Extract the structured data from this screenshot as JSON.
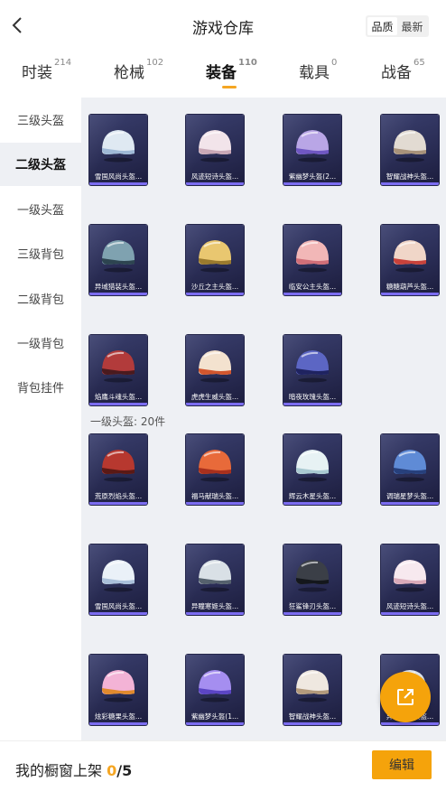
{
  "header": {
    "title": "游戏仓库",
    "sort_options": [
      "品质",
      "最新"
    ],
    "active_sort": 0
  },
  "tabs": [
    {
      "label": "时装",
      "count": "214"
    },
    {
      "label": "枪械",
      "count": "102"
    },
    {
      "label": "装备",
      "count": "110"
    },
    {
      "label": "载具",
      "count": "0"
    },
    {
      "label": "战备",
      "count": "65"
    }
  ],
  "active_tab": 2,
  "sidebar": {
    "items": [
      "三级头盔",
      "二级头盔",
      "一级头盔",
      "三级背包",
      "二级背包",
      "一级背包",
      "背包挂件"
    ],
    "active": 1
  },
  "sections": {
    "level1_label": "一级头盔: 20件"
  },
  "items": [
    {
      "name": "雪国风尚头盔...",
      "colors": [
        "#dfe9f2",
        "#9fb9d6"
      ]
    },
    {
      "name": "风迹短诗头盔...",
      "colors": [
        "#f2e4ea",
        "#c9a8b6"
      ]
    },
    {
      "name": "紫幽梦头盔(2...",
      "colors": [
        "#b9a6e6",
        "#6f57c2"
      ]
    },
    {
      "name": "智耀战神头盔...",
      "colors": [
        "#e2dbd2",
        "#a8927a"
      ]
    },
    {
      "name": "异域猎装头盔...",
      "colors": [
        "#7fa2b0",
        "#2d4450"
      ]
    },
    {
      "name": "沙丘之主头盔...",
      "colors": [
        "#e9c770",
        "#9a7a2e"
      ]
    },
    {
      "name": "临安公主头盔...",
      "colors": [
        "#f2b7b7",
        "#d06e78"
      ]
    },
    {
      "name": "糖糖葫芦头盔...",
      "colors": [
        "#f0d6c8",
        "#c8423b"
      ]
    },
    {
      "name": "焰鹰斗魂头盔...",
      "colors": [
        "#b23b3b",
        "#4a1a1e"
      ]
    },
    {
      "name": "虎虎生威头盔...",
      "colors": [
        "#f3e2cf",
        "#d2562e"
      ]
    },
    {
      "name": "暗夜玫瑰头盔...",
      "colors": [
        "#5c66c4",
        "#1f2360"
      ]
    },
    {
      "name": "荒原烈焰头盔...",
      "colors": [
        "#b7382f",
        "#5a1915"
      ]
    },
    {
      "name": "福马献瑞头盔...",
      "colors": [
        "#e86a3a",
        "#a8301d"
      ]
    },
    {
      "name": "辉云木星头盔...",
      "colors": [
        "#e7f2f4",
        "#a9c9d1"
      ]
    },
    {
      "name": "调瑞星梦头盔...",
      "colors": [
        "#5f8bd6",
        "#27407c"
      ]
    },
    {
      "name": "雪国风尚头盔...",
      "colors": [
        "#eaf1f8",
        "#aac0da"
      ]
    },
    {
      "name": "异瞳寒姬头盔...",
      "colors": [
        "#d9e0e6",
        "#55616d"
      ]
    },
    {
      "name": "狂鲨锋刃头盔...",
      "colors": [
        "#3b3f47",
        "#14171c"
      ]
    },
    {
      "name": "风迹短诗头盔...",
      "colors": [
        "#f7e9ef",
        "#d9aab9"
      ]
    },
    {
      "name": "炫彩糖果头盔...",
      "colors": [
        "#f3b3d6",
        "#e08a2e"
      ]
    },
    {
      "name": "紫幽梦头盔(1...",
      "colors": [
        "#a58ef0",
        "#5b45c4"
      ]
    },
    {
      "name": "智耀战神头盔...",
      "colors": [
        "#efe8e0",
        "#b39a7c"
      ]
    },
    {
      "name": "异域猎装头盔...",
      "colors": [
        "#dfe6ee",
        "#7f90a8"
      ]
    }
  ],
  "footer": {
    "label": "我的橱窗上架",
    "count": "0",
    "total": "/5",
    "edit_label": "编辑"
  },
  "icons": {
    "back": "back-arrow-icon",
    "share": "external-link-icon"
  },
  "accent_color": "#f5a623"
}
